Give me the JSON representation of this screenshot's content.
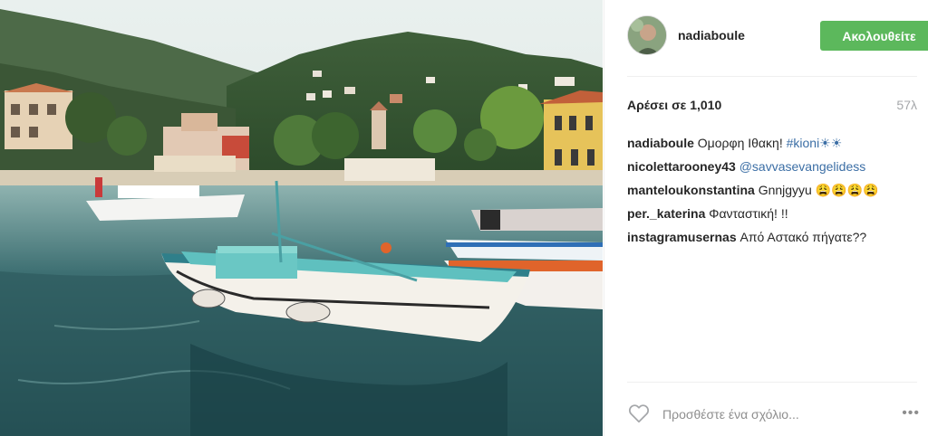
{
  "post": {
    "username": "nadiaboule",
    "follow_label": "Ακολουθείτε",
    "likes_text": "Αρέσει σε 1,010",
    "time_ago": "57λ",
    "image_alt": "Boats in Kioni harbour, Ithaca",
    "comment_placeholder": "Προσθέστε ένα σχόλιο...",
    "more_label": "•••"
  },
  "comments": [
    {
      "user": "nadiaboule",
      "text": "Ομορφη Ιθακη! ",
      "tag": "#kioni☀☀"
    },
    {
      "user": "nicolettarooney43",
      "text": "",
      "tag": "@savvasevangelidess"
    },
    {
      "user": "manteloukonstantina",
      "text": "Gnnjgyyu 😩😩😩😩",
      "tag": ""
    },
    {
      "user": "per._katerina",
      "text": "Φανταστική! !!",
      "tag": ""
    },
    {
      "user": "instagramusernas",
      "text": "Από Αστακό πήγατε??",
      "tag": ""
    }
  ],
  "colors": {
    "follow_bg": "#5cb85c",
    "link": "#3b6ea5",
    "muted": "#a5a7aa"
  },
  "icons": {
    "like": "heart-icon",
    "more": "more-options-icon"
  }
}
